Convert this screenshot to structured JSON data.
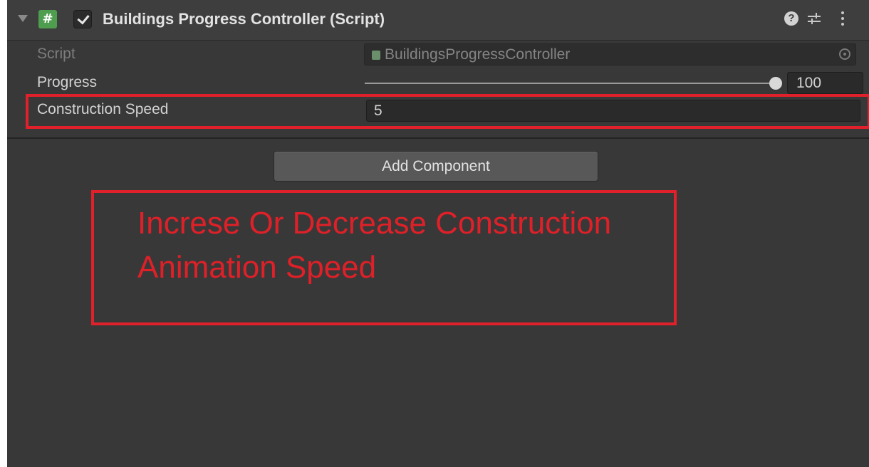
{
  "component": {
    "title": "Buildings Progress Controller (Script)",
    "script_icon_glyph": "#",
    "enabled": true,
    "icons": [
      "foldout-arrow-icon",
      "script-icon",
      "checkbox-check-icon",
      "help-icon",
      "preset-icon",
      "context-menu-icon"
    ]
  },
  "fields": {
    "script": {
      "label": "Script",
      "value": "BuildingsProgressController"
    },
    "progress": {
      "label": "Progress",
      "value": "100",
      "fraction": 1.0
    },
    "construction_speed": {
      "label": "Construction Speed",
      "value": "5"
    }
  },
  "add_component": {
    "label": "Add Component"
  },
  "annotation": {
    "line1": "Increse Or Decrease Construction",
    "line2": "Animation Speed"
  },
  "colors": {
    "background": "#383838",
    "header": "#3e3e3e",
    "annotation_red": "#e0202a",
    "script_icon_green": "#4f9d4f"
  }
}
